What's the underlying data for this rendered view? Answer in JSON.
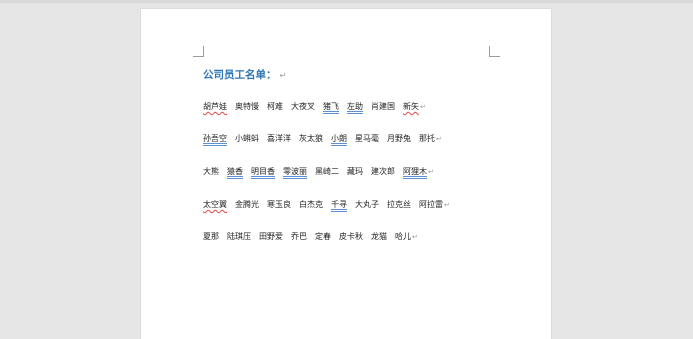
{
  "document": {
    "title": "公司员工名单：",
    "paragraph_mark": "↵",
    "rows": [
      {
        "names": [
          {
            "text": "胡芦娃",
            "mark": "squig"
          },
          {
            "text": "奥特慢",
            "mark": ""
          },
          {
            "text": "柯难",
            "mark": ""
          },
          {
            "text": "大夜叉",
            "mark": ""
          },
          {
            "text": "猪飞",
            "mark": "blueline"
          },
          {
            "text": "左助",
            "mark": "blueline"
          },
          {
            "text": "肖建国",
            "mark": ""
          },
          {
            "text": "新矢",
            "mark": "squig"
          }
        ]
      },
      {
        "names": [
          {
            "text": "孙吾空",
            "mark": "blueline"
          },
          {
            "text": "小蝌蚪",
            "mark": ""
          },
          {
            "text": "喜洋洋",
            "mark": ""
          },
          {
            "text": "灰太狼",
            "mark": ""
          },
          {
            "text": "小朗",
            "mark": "blueline"
          },
          {
            "text": "星马毫",
            "mark": ""
          },
          {
            "text": "月野兔",
            "mark": ""
          },
          {
            "text": "那托",
            "mark": ""
          }
        ]
      },
      {
        "names": [
          {
            "text": "大熊",
            "mark": ""
          },
          {
            "text": "猿香",
            "mark": "blueline"
          },
          {
            "text": "明目香",
            "mark": "blueline"
          },
          {
            "text": "零波丽",
            "mark": "blueline"
          },
          {
            "text": "黑崎二",
            "mark": ""
          },
          {
            "text": "藏玛",
            "mark": ""
          },
          {
            "text": "建次郎",
            "mark": ""
          },
          {
            "text": "阿狸木",
            "mark": "blueline"
          }
        ]
      },
      {
        "names": [
          {
            "text": "太空翼",
            "mark": "squig"
          },
          {
            "text": "金腾光",
            "mark": ""
          },
          {
            "text": "寒玉良",
            "mark": ""
          },
          {
            "text": "白杰克",
            "mark": ""
          },
          {
            "text": "千寻",
            "mark": "blueline"
          },
          {
            "text": "大丸子",
            "mark": ""
          },
          {
            "text": "拉克丝",
            "mark": ""
          },
          {
            "text": "阿拉雷",
            "mark": ""
          }
        ]
      },
      {
        "names": [
          {
            "text": "夏那",
            "mark": ""
          },
          {
            "text": "陆琪压",
            "mark": ""
          },
          {
            "text": "田野爱",
            "mark": ""
          },
          {
            "text": "乔巴",
            "mark": ""
          },
          {
            "text": "定春",
            "mark": ""
          },
          {
            "text": "皮卡秋",
            "mark": ""
          },
          {
            "text": "龙猫",
            "mark": ""
          },
          {
            "text": "哈儿",
            "mark": ""
          }
        ]
      }
    ]
  }
}
